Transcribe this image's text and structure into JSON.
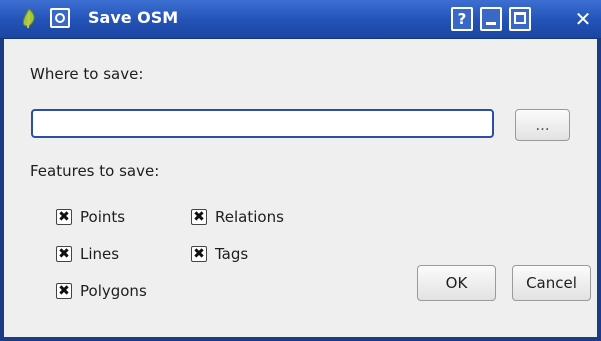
{
  "window": {
    "title": "Save OSM",
    "help_label": "?",
    "close_label": "✕"
  },
  "form": {
    "where_label": "Where to save:",
    "path_value": "",
    "browse_label": "...",
    "features_label": "Features to save:"
  },
  "features": {
    "points": {
      "label": "Points",
      "checked": true
    },
    "relations": {
      "label": "Relations",
      "checked": true
    },
    "lines": {
      "label": "Lines",
      "checked": true
    },
    "tags": {
      "label": "Tags",
      "checked": true
    },
    "polygons": {
      "label": "Polygons",
      "checked": true
    }
  },
  "buttons": {
    "ok_label": "OK",
    "cancel_label": "Cancel"
  },
  "check_mark": "✖",
  "colors": {
    "titlebar": "#2352b6",
    "input_border": "#2b4ea8",
    "window_bg": "#efefef"
  }
}
